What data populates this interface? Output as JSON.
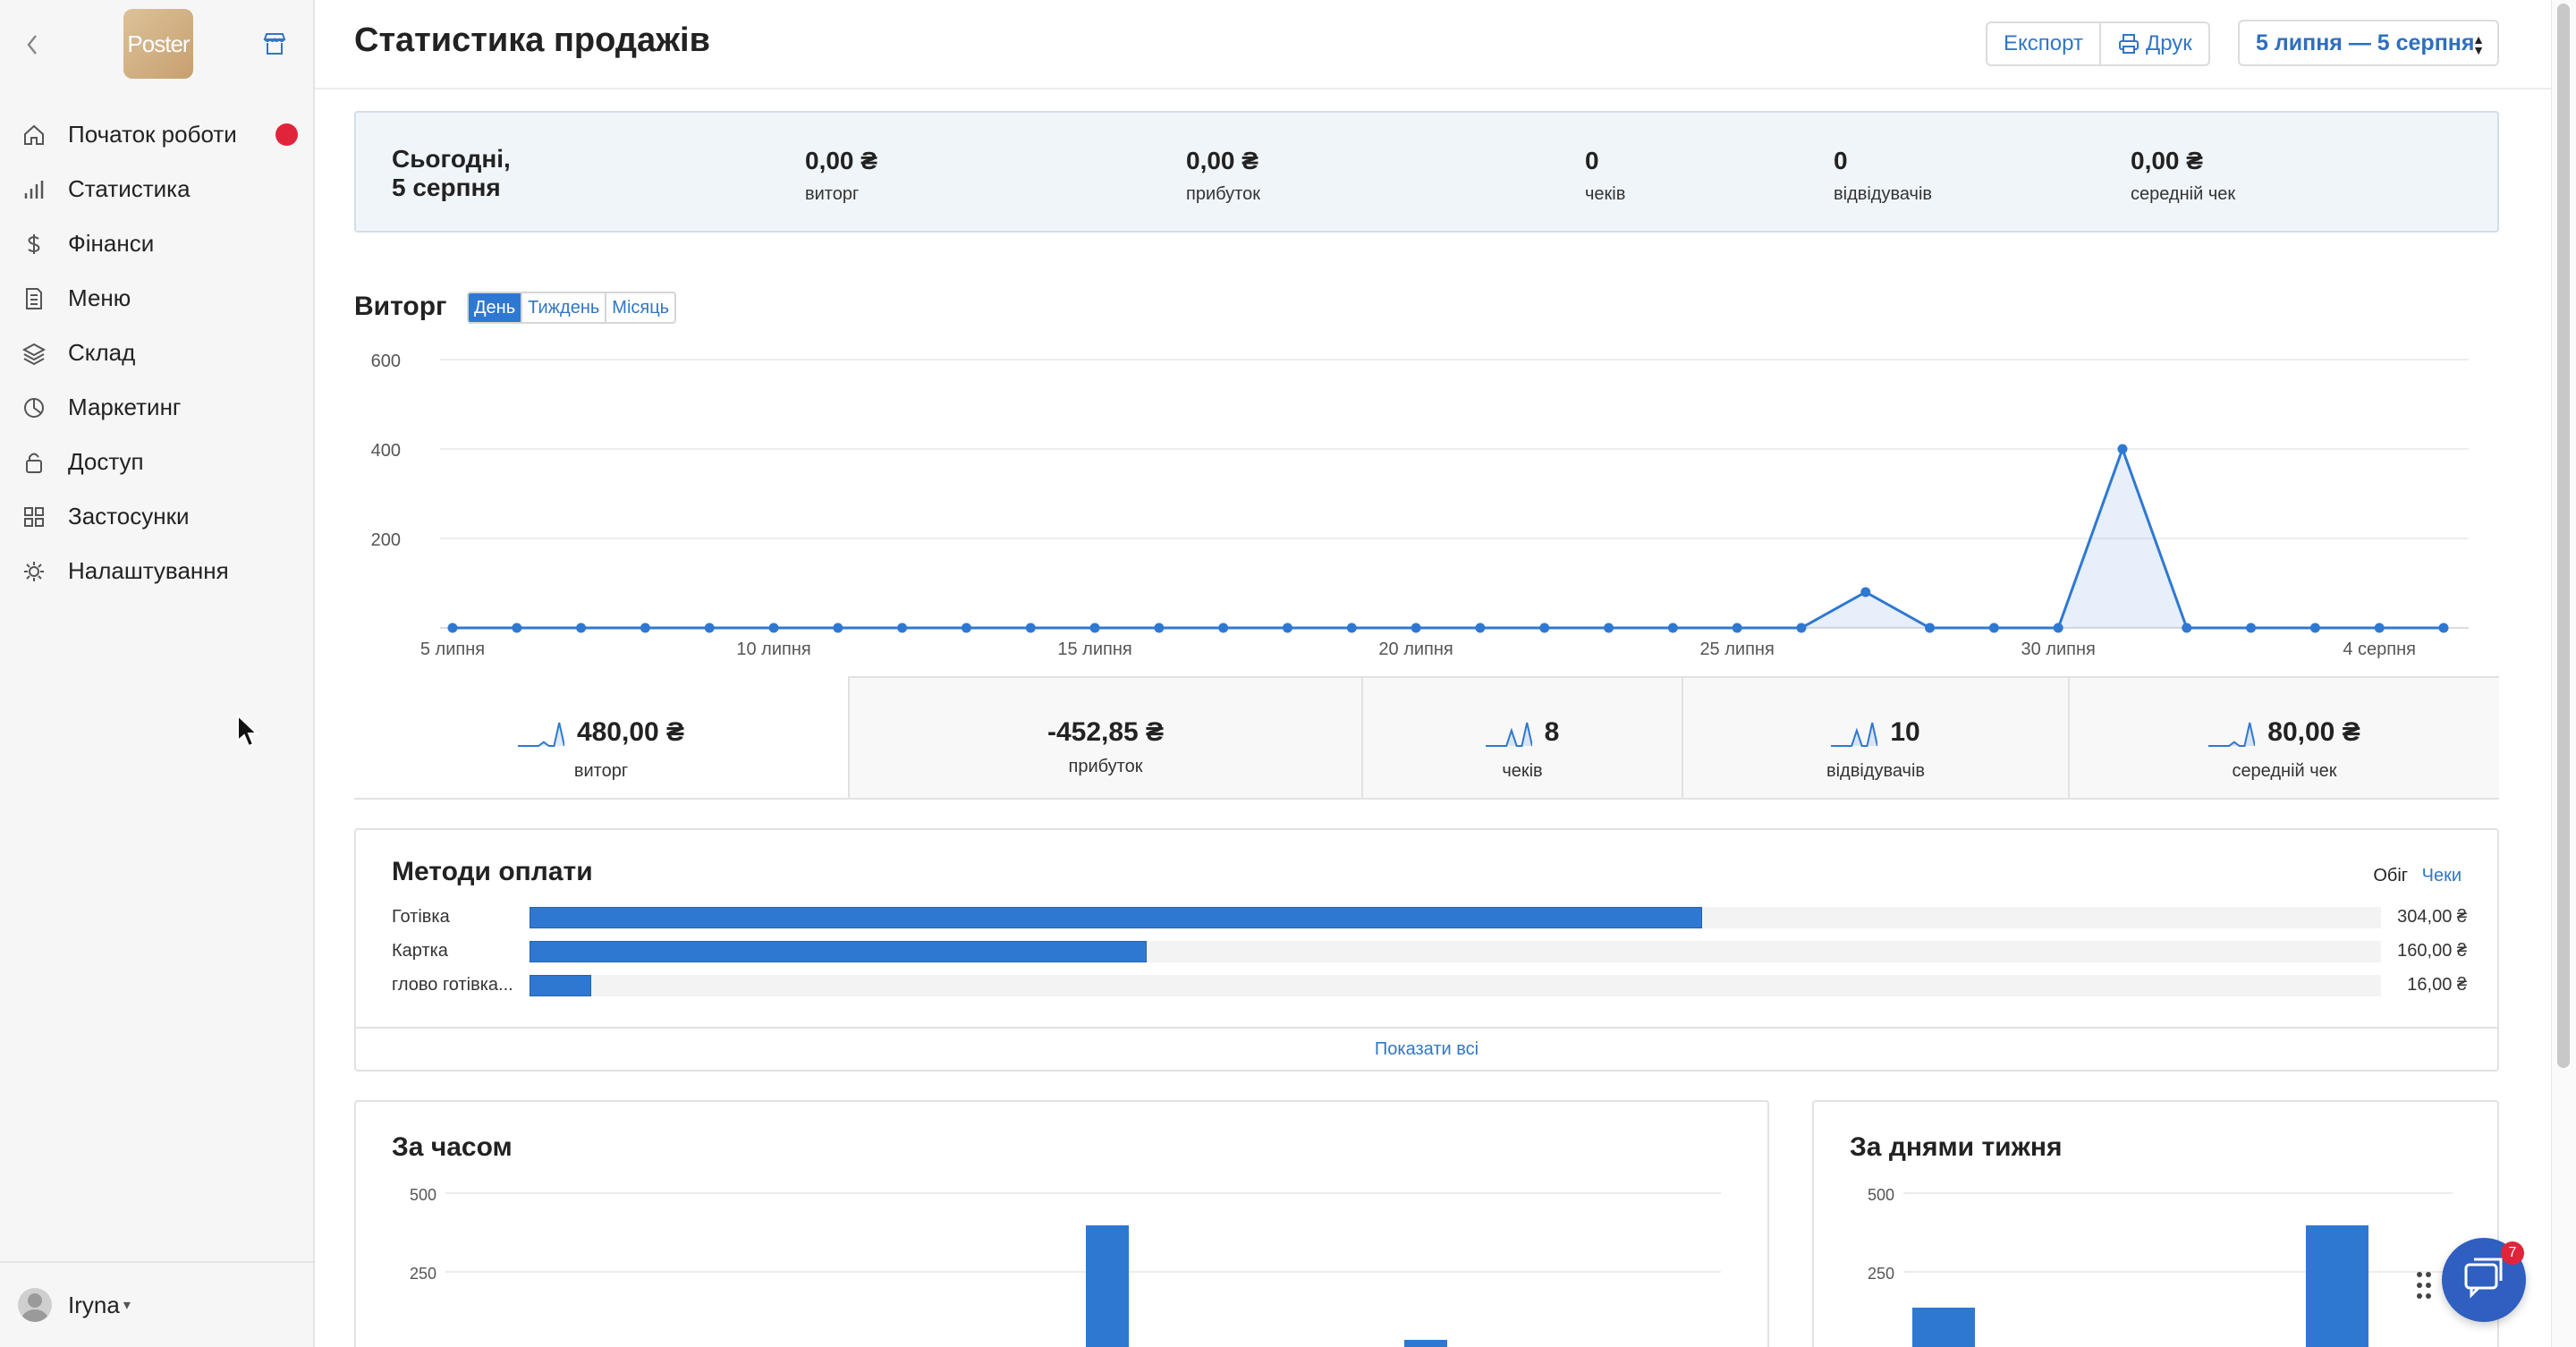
{
  "sidebar": {
    "logo_text": "Poster",
    "items": [
      {
        "label": "Початок роботи",
        "icon": "home-icon",
        "has_badge": true
      },
      {
        "label": "Статистика",
        "icon": "bar-chart-icon"
      },
      {
        "label": "Фінанси",
        "icon": "dollar-icon"
      },
      {
        "label": "Меню",
        "icon": "document-icon"
      },
      {
        "label": "Склад",
        "icon": "layers-icon"
      },
      {
        "label": "Маркетинг",
        "icon": "pie-icon"
      },
      {
        "label": "Доступ",
        "icon": "lock-icon"
      },
      {
        "label": "Застосунки",
        "icon": "grid-icon"
      },
      {
        "label": "Налаштування",
        "icon": "gear-icon"
      }
    ],
    "user": {
      "name": "Iryna",
      "caret": "▾"
    }
  },
  "header": {
    "title": "Статистика продажів",
    "export_label": "Експорт",
    "print_label": "Друк",
    "date_range": "5 липня — 5 серпня"
  },
  "today": {
    "label_line1": "Сьогодні,",
    "label_line2": "5 серпня",
    "stats": [
      {
        "value": "0,00 ₴",
        "caption": "виторг"
      },
      {
        "value": "0,00 ₴",
        "caption": "прибуток"
      },
      {
        "value": "0",
        "caption": "чеків"
      },
      {
        "value": "0",
        "caption": "відвідувачів"
      },
      {
        "value": "0,00 ₴",
        "caption": "середній чек"
      }
    ]
  },
  "revenue": {
    "title": "Виторг",
    "periods": [
      "День",
      "Тиждень",
      "Місяць"
    ],
    "active_period": "День"
  },
  "chart_data": {
    "type": "area",
    "title": "Виторг",
    "x_tick_labels": [
      "5 липня",
      "10 липня",
      "15 липня",
      "20 липня",
      "25 липня",
      "30 липня",
      "4 серпня"
    ],
    "y_tick_labels": [
      "200",
      "400",
      "600"
    ],
    "ylim": [
      0,
      600
    ],
    "grid": true,
    "series": [
      {
        "values": [
          0,
          0,
          0,
          0,
          0,
          0,
          0,
          0,
          0,
          0,
          0,
          0,
          0,
          0,
          0,
          0,
          0,
          0,
          0,
          0,
          0,
          0,
          80,
          0,
          0,
          0,
          400,
          0,
          0,
          0,
          0,
          0
        ]
      }
    ],
    "color": "#2f78d2"
  },
  "kpis": [
    {
      "value": "480,00 ₴",
      "caption": "виторг",
      "spark": [
        0,
        0,
        0,
        0,
        0,
        1,
        0,
        0,
        6,
        0
      ]
    },
    {
      "value": "-452,85 ₴",
      "caption": "прибуток"
    },
    {
      "value": "8",
      "caption": "чеків",
      "spark": [
        0,
        0,
        0,
        0,
        0,
        4,
        0,
        0,
        6,
        0
      ]
    },
    {
      "value": "10",
      "caption": "відвідувачів",
      "spark": [
        0,
        0,
        0,
        0,
        0,
        4,
        0,
        0,
        6,
        0
      ]
    },
    {
      "value": "80,00 ₴",
      "caption": "середній чек",
      "spark": [
        0,
        0,
        0,
        0,
        0,
        1,
        0,
        0,
        6,
        0
      ]
    }
  ],
  "payments": {
    "title": "Методи оплати",
    "toggle_a": "Обіг",
    "toggle_b": "Чеки",
    "rows": [
      {
        "name": "Готівка",
        "amount": "304,00 ₴",
        "value": 304
      },
      {
        "name": "Картка",
        "amount": "160,00 ₴",
        "value": 160
      },
      {
        "name": "глово готівка...",
        "amount": "16,00 ₴",
        "value": 16
      }
    ],
    "max": 480,
    "show_all": "Показати всі"
  },
  "by_time": {
    "title": "За часом",
    "y_tick_labels": [
      "250",
      "500"
    ]
  },
  "by_weekday": {
    "title": "За днями тижня",
    "y_tick_labels": [
      "250",
      "500"
    ]
  },
  "chat": {
    "badge": "7"
  },
  "colors": {
    "accent": "#2f78d2",
    "badge": "#e0253a",
    "link": "#3276c3"
  }
}
